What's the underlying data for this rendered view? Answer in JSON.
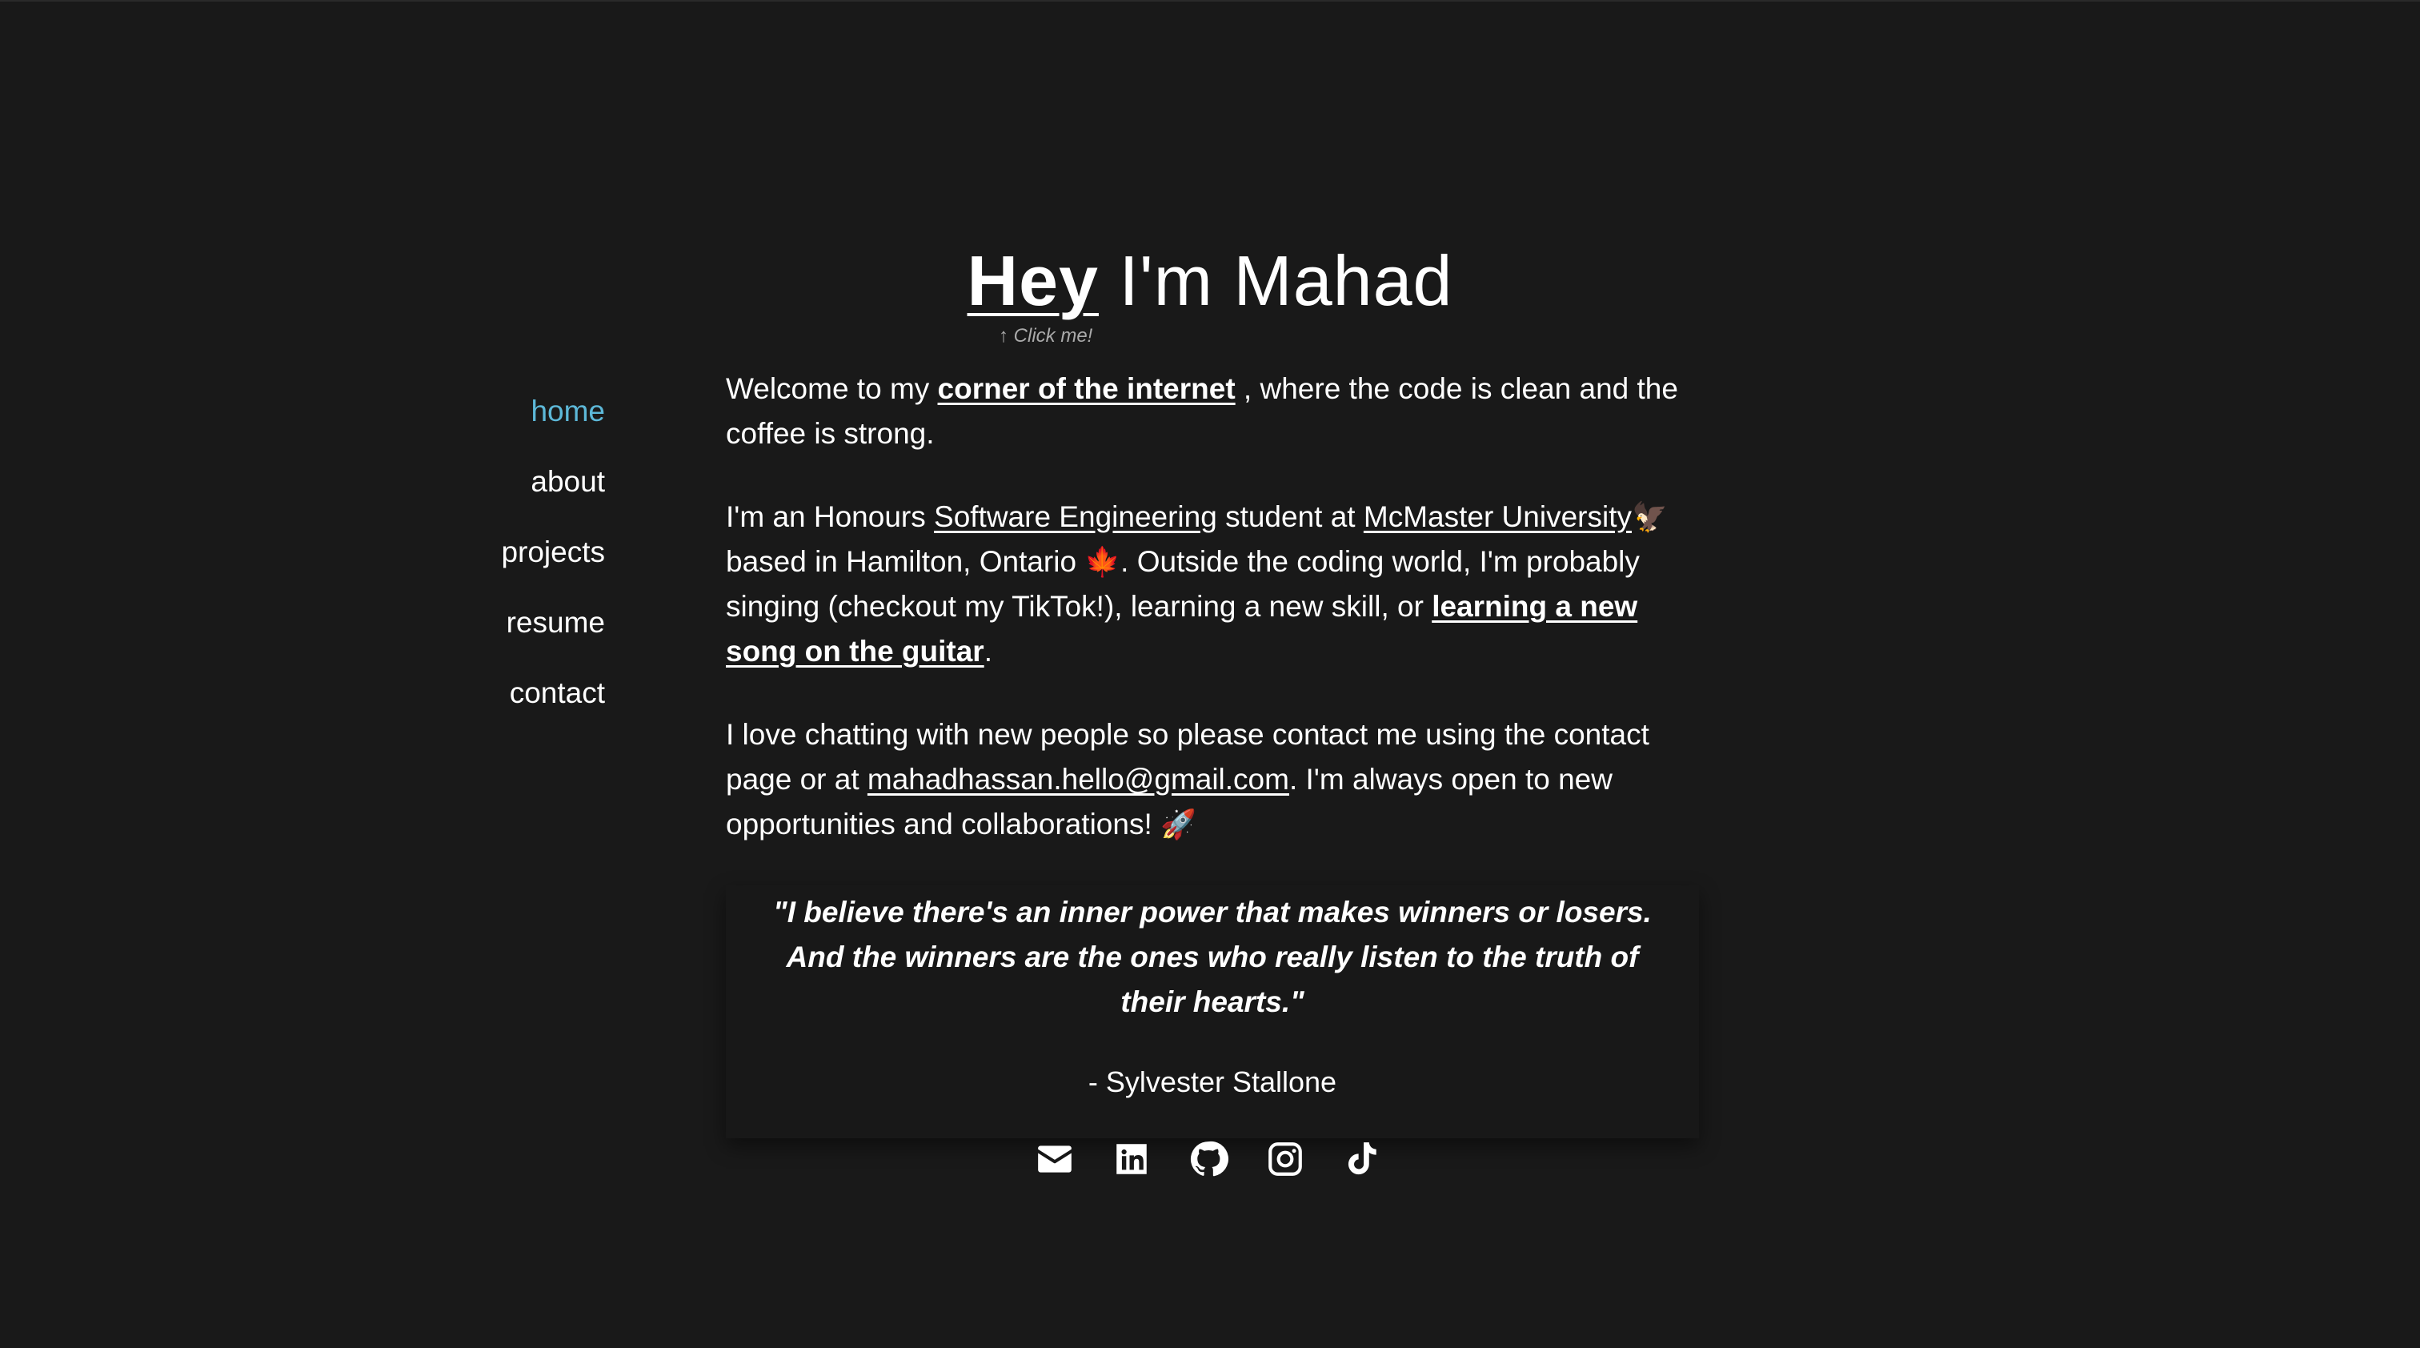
{
  "hero": {
    "title_link": "Hey",
    "title_rest": " I'm Mahad",
    "click_hint": "↑ Click me!"
  },
  "nav": {
    "items": [
      {
        "label": "home",
        "active": true
      },
      {
        "label": "about",
        "active": false
      },
      {
        "label": "projects",
        "active": false
      },
      {
        "label": "resume",
        "active": false
      },
      {
        "label": "contact",
        "active": false
      }
    ]
  },
  "intro": {
    "p1_before": "Welcome to my ",
    "p1_link": "corner of the internet",
    "p1_after": " , where the code is clean and the coffee is strong.",
    "p2_a": "I'm an Honours ",
    "p2_link1": "Software Engineering",
    "p2_b": " student at ",
    "p2_link2": "McMaster University",
    "p2_c": " based in Hamilton, Ontario ",
    "p2_d": ". Outside the coding world, I'm probably singing (checkout my TikTok!), learning a new skill, or ",
    "p2_link3": "learning a new song on the guitar",
    "p2_e": ".",
    "p3_a": "I love chatting with new people so please contact me using the contact page or at ",
    "p3_link": "mahadhassan.hello@gmail.com",
    "p3_b": ". I'm always open to new opportunities and collaborations! ",
    "emoji_bird": "🦅",
    "emoji_leaf": "🍁",
    "emoji_rocket": "🚀"
  },
  "quote": {
    "text": "\"I believe there's an inner power that makes winners or losers. And the winners are the ones who really listen to the truth of their hearts.\"",
    "author": "- Sylvester Stallone"
  },
  "socials": {
    "icons": [
      "email-icon",
      "linkedin-icon",
      "github-icon",
      "instagram-icon",
      "tiktok-icon"
    ]
  },
  "colors": {
    "background": "#191919",
    "text": "#ffffff",
    "accent": "#5db8d8"
  }
}
